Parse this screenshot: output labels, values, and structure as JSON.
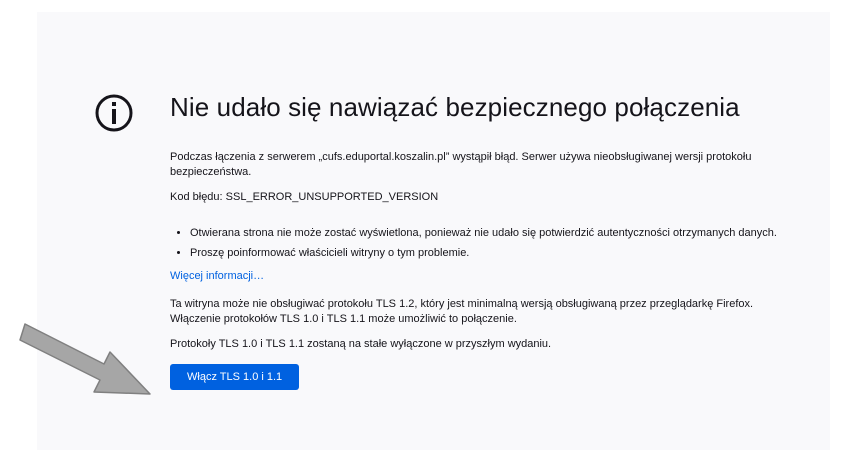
{
  "error": {
    "title": "Nie udało się nawiązać bezpiecznego połączenia",
    "description": "Podczas łączenia z serwerem „cufs.eduportal.koszalin.pl” wystąpił błąd. Serwer używa nieobsługiwanej wersji protokołu bezpieczeństwa.",
    "code_line": "Kod błędu: SSL_ERROR_UNSUPPORTED_VERSION",
    "bullets": [
      "Otwierana strona nie może zostać wyświetlona, ponieważ nie udało się potwierdzić autentyczności otrzymanych danych.",
      "Proszę poinformować właścicieli witryny o tym problemie."
    ],
    "learn_more": "Więcej informacji…",
    "tls_note": "Ta witryna może nie obsługiwać protokołu TLS 1.2, który jest minimalną wersją obsługiwaną przez przeglądarkę Firefox. Włączenie protokołów TLS 1.0 i TLS 1.1 może umożliwić to połączenie.",
    "tls_disabled": "Protokoły TLS 1.0 i TLS 1.1 zostaną na stałe wyłączone w przyszłym wydaniu.",
    "enable_button": "Włącz TLS 1.0 i 1.1"
  },
  "icons": {
    "info": "info-icon",
    "arrow": "arrow-annotation-icon"
  },
  "colors": {
    "accent": "#0061e0",
    "panel_bg": "#f9f9fb",
    "text": "#15141a",
    "arrow_fill": "#a6a6a6",
    "arrow_stroke": "#808080"
  }
}
